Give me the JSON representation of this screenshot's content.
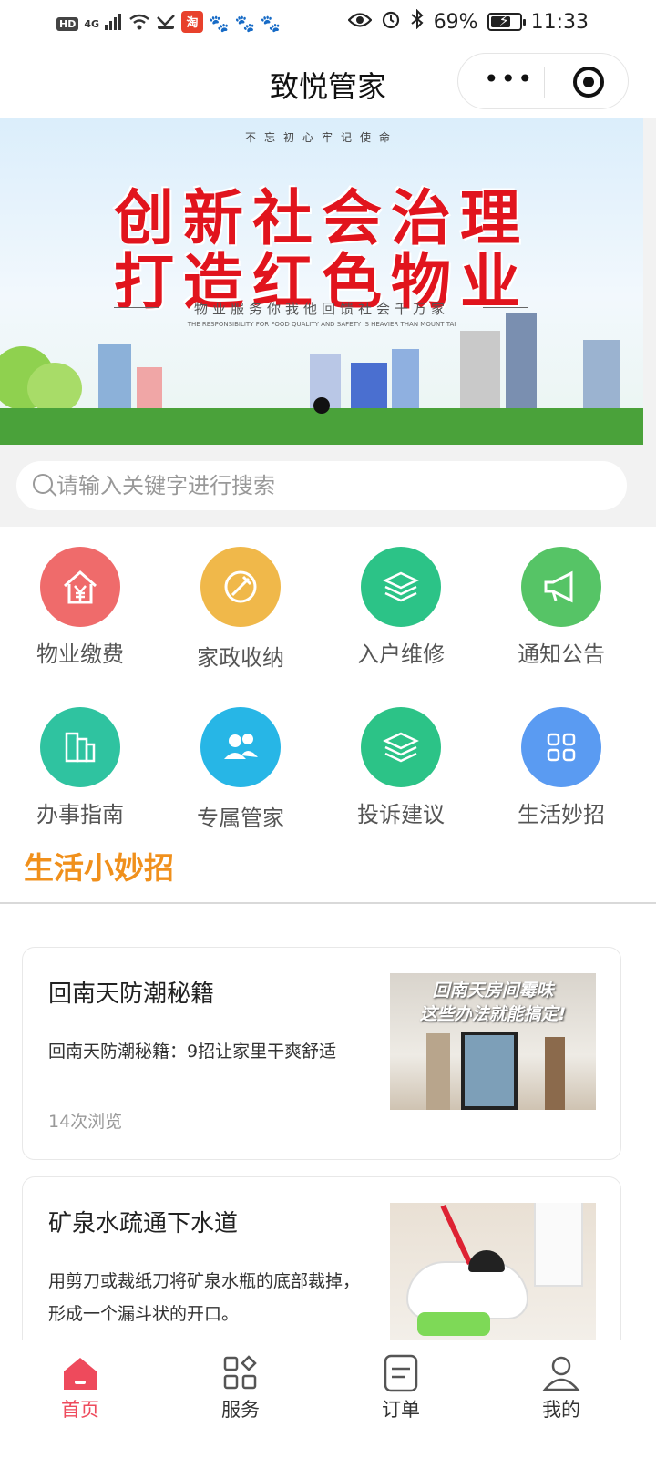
{
  "status_bar": {
    "signal": "4G",
    "battery": "69%",
    "battery_level": 0.69,
    "time": "11:33"
  },
  "nav": {
    "title": "致悦管家"
  },
  "banner": {
    "top_line": "不忘初心牢记使命",
    "line1": "创新社会治理",
    "line2": "打造红色物业",
    "subtitle": "物业服务你我他回馈社会千万家",
    "english": "THE RESPONSIBILITY FOR FOOD QUALITY AND SAFETY IS HEAVIER THAN MOUNT TAI"
  },
  "search": {
    "placeholder": "请输入关键字进行搜索"
  },
  "services": [
    {
      "label": "物业缴费",
      "icon": "yen-house-icon",
      "color": "#ef6b6b"
    },
    {
      "label": "家政收纳",
      "icon": "wrench-icon",
      "color": "#f0b84a"
    },
    {
      "label": "入户维修",
      "icon": "layers-icon",
      "color": "#2cc387"
    },
    {
      "label": "通知公告",
      "icon": "megaphone-icon",
      "color": "#56c466"
    },
    {
      "label": "办事指南",
      "icon": "buildings-icon",
      "color": "#2fc3a0"
    },
    {
      "label": "专属管家",
      "icon": "people-icon",
      "color": "#27b6e6"
    },
    {
      "label": "投诉建议",
      "icon": "layers-icon",
      "color": "#2cc387"
    },
    {
      "label": "生活妙招",
      "icon": "grid-icon",
      "color": "#5a9bf2"
    }
  ],
  "section": {
    "title": "生活小妙招"
  },
  "articles": [
    {
      "title": "回南天防潮秘籍",
      "desc": "回南天防潮秘籍：9招让家里干爽舒适",
      "views": "14次浏览",
      "thumb_caption_1": "回南天房间霉味",
      "thumb_caption_2": "这些办法就能搞定!"
    },
    {
      "title": "矿泉水疏通下水道",
      "desc": "用剪刀或裁纸刀将矿泉水瓶的底部裁掉，形成一个漏斗状的开口。",
      "views": ""
    }
  ],
  "tabs": [
    {
      "label": "首页",
      "icon": "home-icon",
      "active": true
    },
    {
      "label": "服务",
      "icon": "apps-icon",
      "active": false
    },
    {
      "label": "订单",
      "icon": "order-icon",
      "active": false
    },
    {
      "label": "我的",
      "icon": "user-icon",
      "active": false
    }
  ],
  "colors": {
    "accent": "#ee4a5c",
    "section_title": "#f0901c"
  }
}
